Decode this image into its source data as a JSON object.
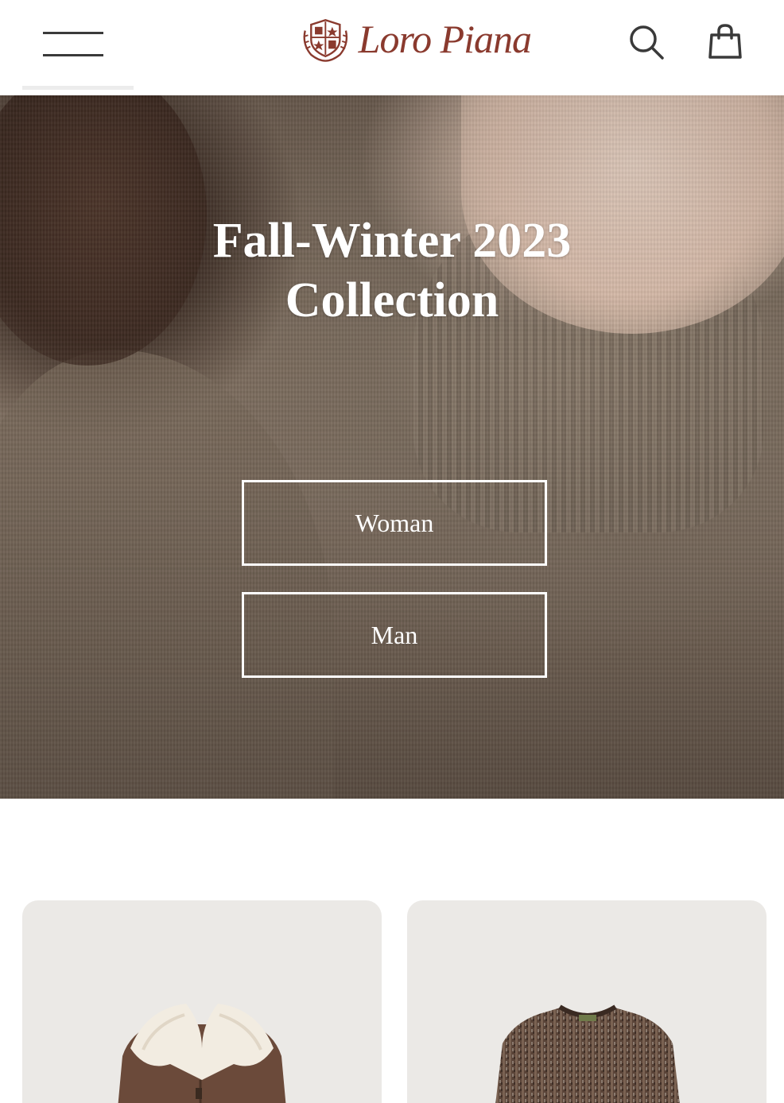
{
  "header": {
    "brand": "Loro Piana",
    "menu_icon": "hamburger-menu-icon",
    "search_icon": "search-icon",
    "bag_icon": "shopping-bag-icon",
    "brand_color": "#8a3a2e"
  },
  "hero": {
    "title_line1": "Fall-Winter 2023",
    "title_line2": "Collection",
    "buttons": [
      {
        "label": "Woman"
      },
      {
        "label": "Man"
      }
    ]
  },
  "products": [
    {
      "image": "shearling-collar-leather-jacket"
    },
    {
      "image": "marled-knit-crewneck-sweater"
    }
  ]
}
